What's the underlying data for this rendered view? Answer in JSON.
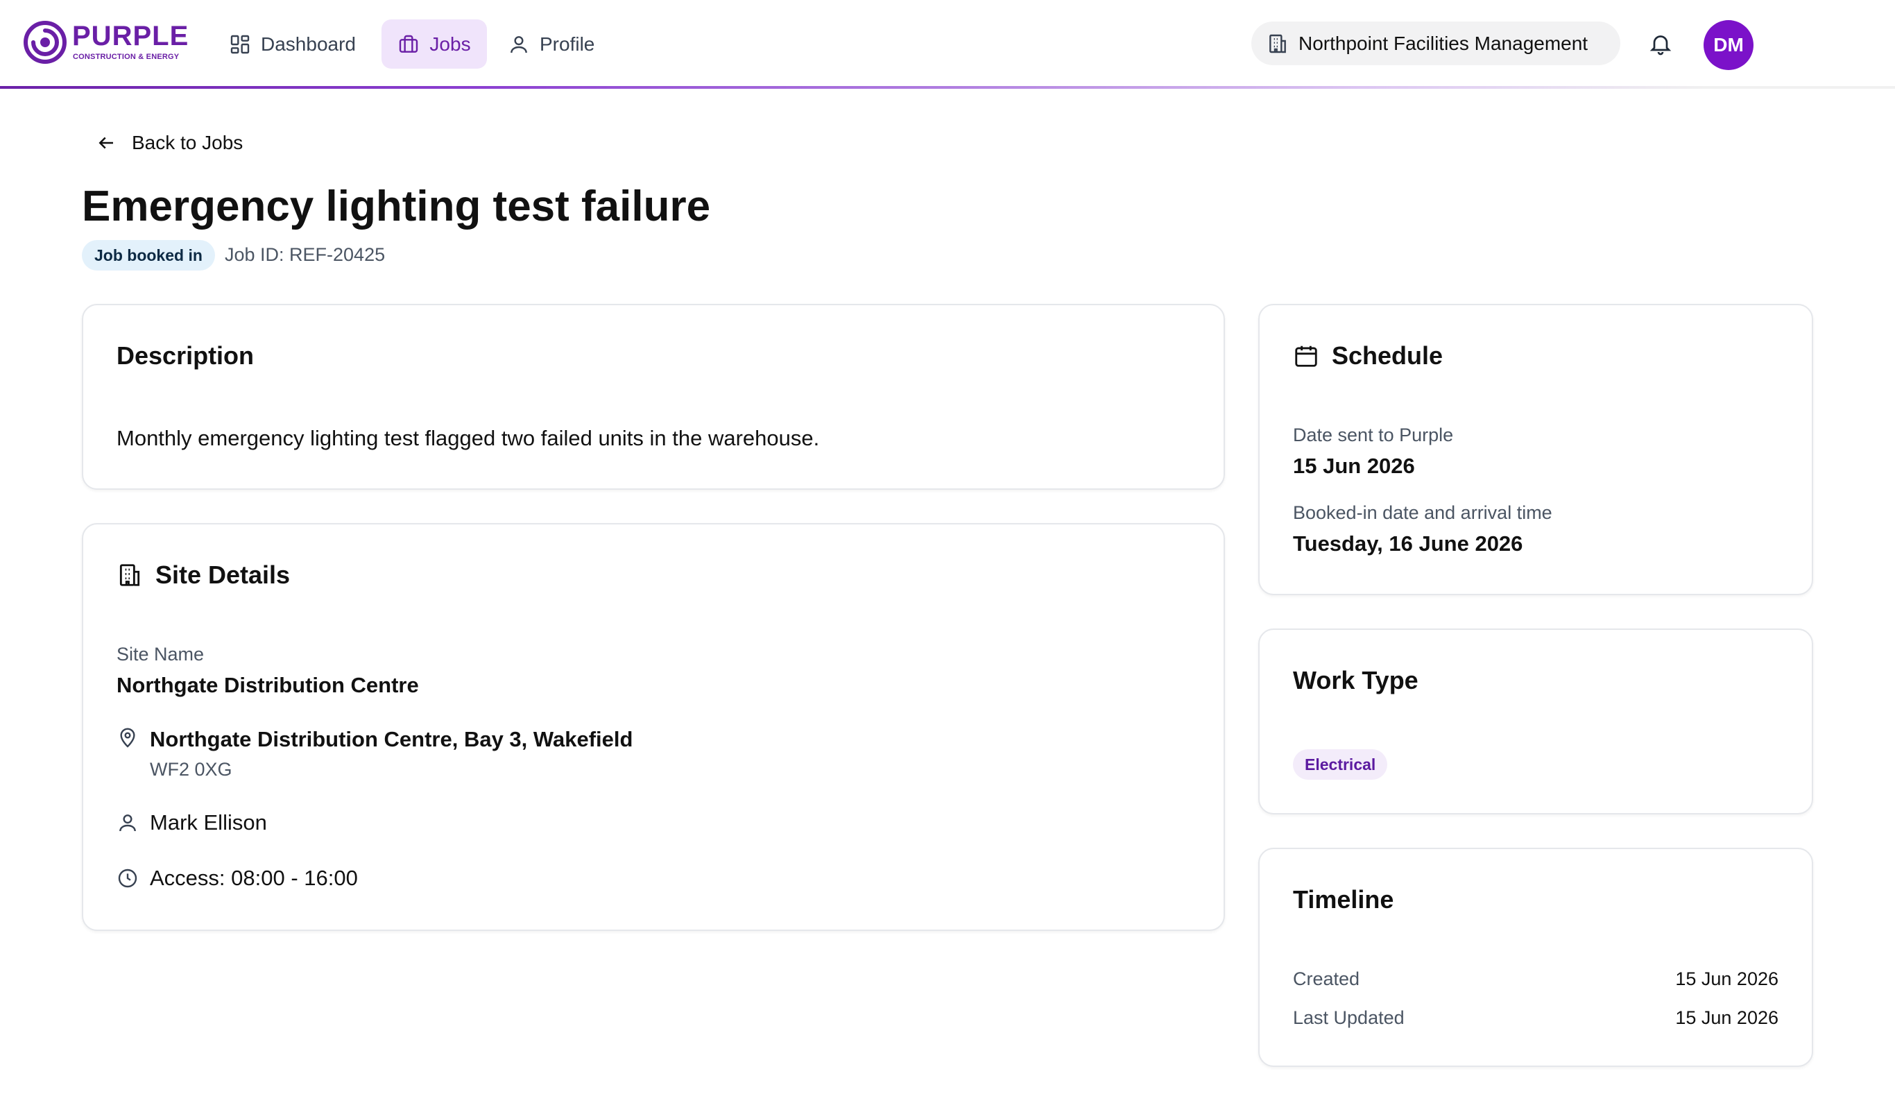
{
  "header": {
    "brand": "PURPLE",
    "brand_sub": "CONSTRUCTION & ENERGY",
    "nav": [
      {
        "label": "Dashboard",
        "icon": "dashboard-icon"
      },
      {
        "label": "Jobs",
        "icon": "briefcase-icon",
        "active": true
      },
      {
        "label": "Profile",
        "icon": "user-icon"
      }
    ],
    "organization": "Northpoint Facilities Management",
    "avatar_initials": "DM"
  },
  "page": {
    "back_label": "Back to Jobs",
    "title": "Emergency lighting test failure",
    "status": "Job booked in",
    "job_id": "Job ID: REF-20425"
  },
  "description": {
    "heading": "Description",
    "text": "Monthly emergency lighting test flagged two failed units in the warehouse."
  },
  "site": {
    "heading": "Site Details",
    "site_name_label": "Site Name",
    "site_name": "Northgate Distribution Centre",
    "address": "Northgate Distribution Centre, Bay 3, Wakefield",
    "postcode": "WF2 0XG",
    "contact": "Mark Ellison",
    "access": "Access: 08:00 - 16:00"
  },
  "schedule": {
    "heading": "Schedule",
    "sent_label": "Date sent to Purple",
    "sent_value": "15 Jun 2026",
    "booked_label": "Booked-in date and arrival time",
    "booked_value": "Tuesday, 16 June 2026"
  },
  "work_type": {
    "heading": "Work Type",
    "tag": "Electrical"
  },
  "timeline": {
    "heading": "Timeline",
    "rows": [
      {
        "label": "Created",
        "value": "15 Jun 2026"
      },
      {
        "label": "Last Updated",
        "value": "15 Jun 2026"
      }
    ]
  },
  "colors": {
    "brand": "#6a1fa6",
    "avatar": "#7b12c9",
    "status_badge_bg": "#e3f1fb",
    "worktype_bg": "#f3ecfa"
  }
}
